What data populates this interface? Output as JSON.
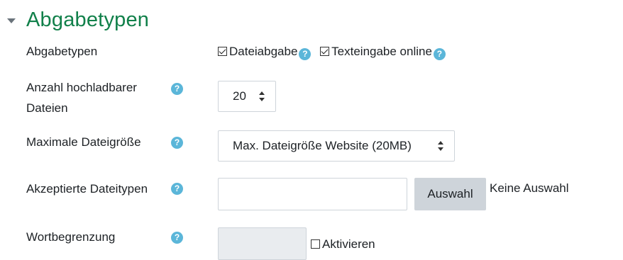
{
  "section": {
    "title": "Abgabetypen"
  },
  "rows": {
    "types": {
      "label": "Abgabetypen",
      "file_submission": {
        "label": "Dateiabgabe",
        "checked": true
      },
      "online_text": {
        "label": "Texteingabe online",
        "checked": true
      }
    },
    "max_files": {
      "label_line1": "Anzahl hochladbarer",
      "label_line2": "Dateien",
      "value": "20"
    },
    "max_size": {
      "label": "Maximale Dateigröße",
      "value": "Max. Dateigröße Website (20MB)"
    },
    "accepted_types": {
      "label": "Akzeptierte Dateitypen",
      "input_value": "",
      "choose_button": "Auswahl",
      "status": "Keine Auswahl"
    },
    "word_limit": {
      "label": "Wortbegrenzung",
      "input_value": "",
      "enable_label": "Aktivieren",
      "enable_checked": false
    }
  },
  "help_glyph": "?",
  "colors": {
    "section_title": "#11804a",
    "help_icon": "#5bb6d9",
    "button_bg": "#ced4da",
    "disabled_input_bg": "#e9ecef"
  }
}
